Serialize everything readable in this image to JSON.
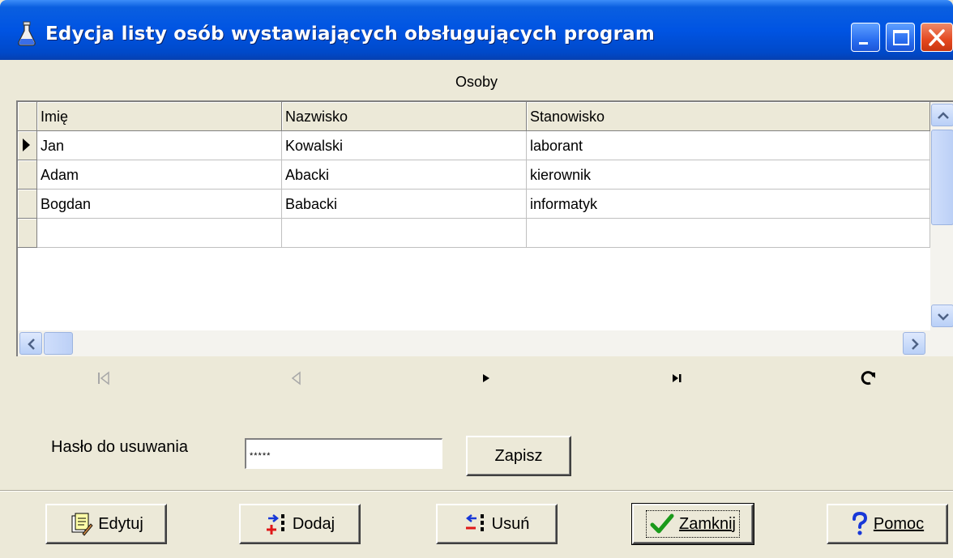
{
  "window": {
    "title": "Edycja listy osób wystawiających obsługujących program",
    "icon": "flask-icon",
    "controls": [
      "minimize-icon",
      "maximize-icon",
      "close-icon"
    ]
  },
  "section_label": "Osoby",
  "grid": {
    "columns": [
      "Imię",
      "Nazwisko",
      "Stanowisko"
    ],
    "rows": [
      [
        "Jan",
        "Kowalski",
        "laborant"
      ],
      [
        "Adam",
        "Abacki",
        "kierownik"
      ],
      [
        "Bogdan",
        "Babacki",
        "informatyk"
      ],
      [
        "",
        "",
        ""
      ]
    ],
    "current_row_indicator": "row-pointer-icon"
  },
  "navigator": [
    "first-record-icon",
    "prior-record-icon",
    "next-record-icon",
    "last-record-icon",
    "refresh-icon"
  ],
  "password": {
    "label": "Hasło do usuwania",
    "value": "*****",
    "save_label": "Zapisz"
  },
  "buttons": {
    "edit": "Edytuj",
    "add": "Dodaj",
    "delete": "Usuń",
    "close": "Zamknij",
    "help": "Pomoc"
  }
}
